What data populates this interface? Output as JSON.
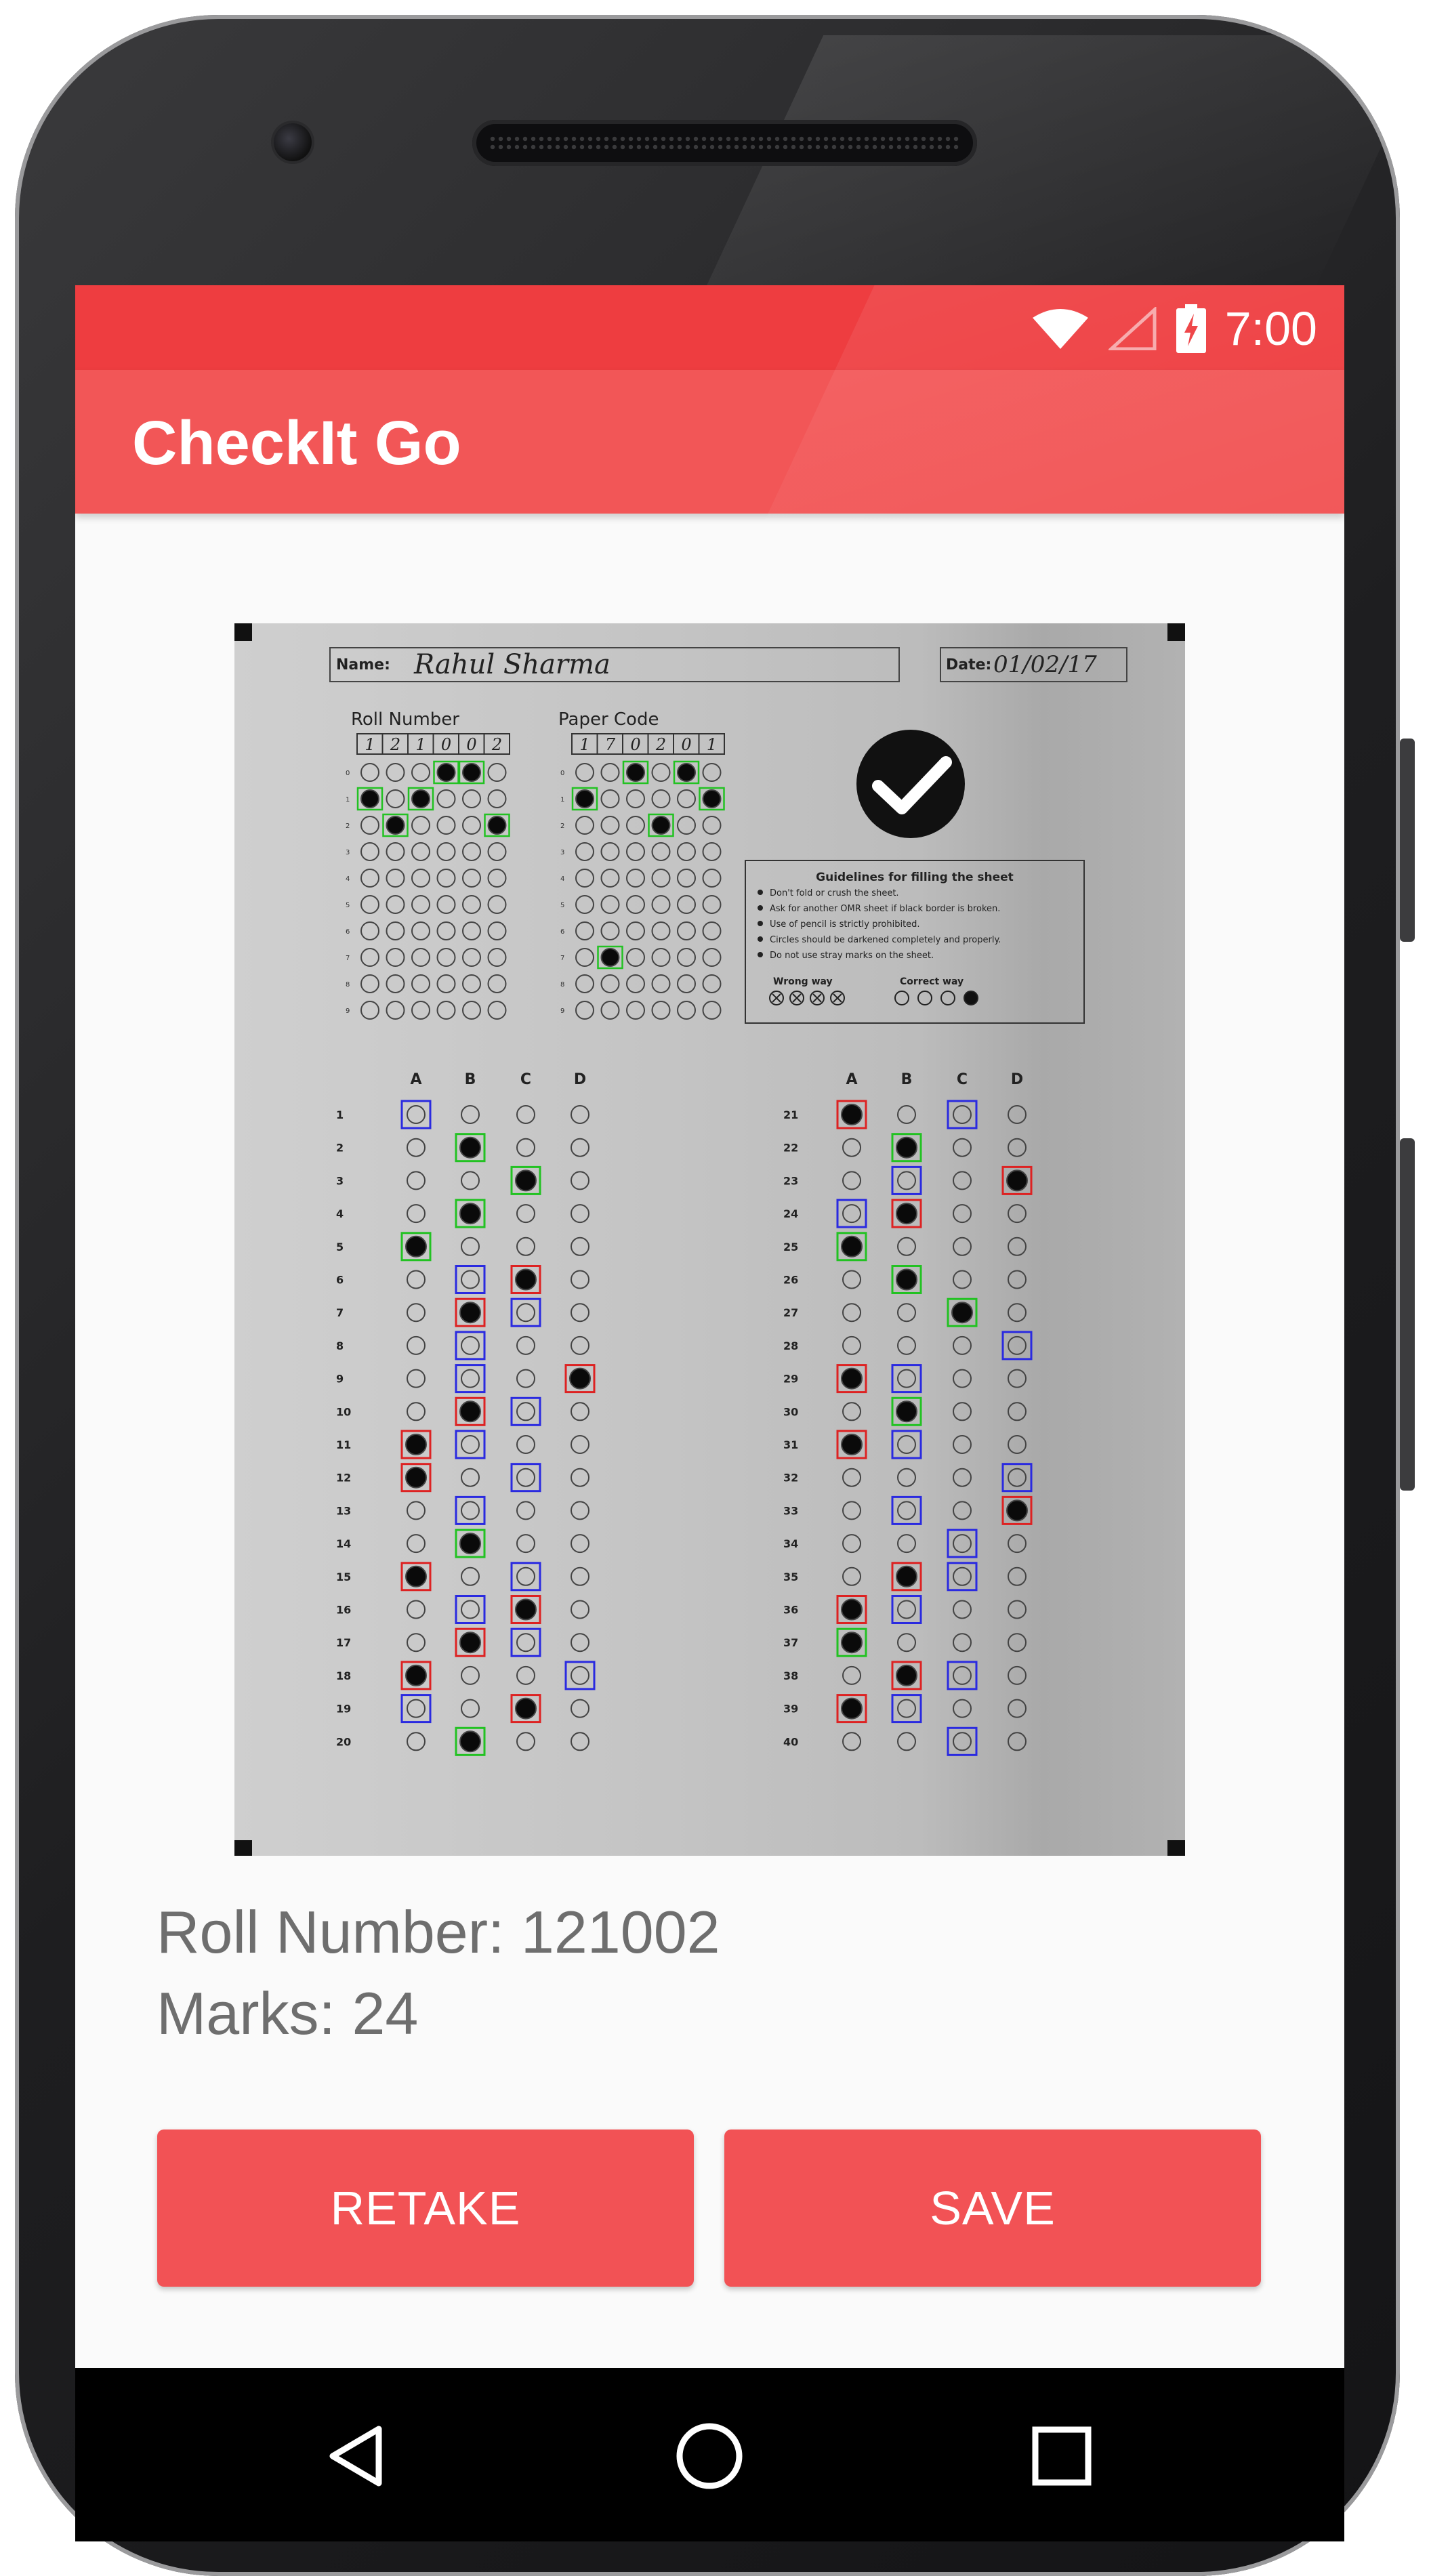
{
  "status_bar": {
    "time": "7:00",
    "icons": [
      "wifi-icon",
      "cell-signal-icon",
      "battery-charging-icon"
    ]
  },
  "app_bar": {
    "title": "CheckIt Go"
  },
  "omr_sheet": {
    "name_label": "Name:",
    "name_value": "Rahul Sharma",
    "date_label": "Date:",
    "date_value": "01/02/17",
    "roll_number_label": "Roll Number",
    "roll_number_digits": [
      "1",
      "2",
      "1",
      "0",
      "0",
      "2"
    ],
    "paper_code_label": "Paper Code",
    "paper_code_digits": [
      "1",
      "7",
      "0",
      "2",
      "0",
      "1"
    ],
    "guidelines_title": "Guidelines for filling the sheet",
    "guidelines": [
      "Don't fold or crush the sheet.",
      "Ask for another OMR sheet if black border is broken.",
      "Use of pencil is strictly prohibited.",
      "Circles should be darkened completely and properly.",
      "Do not use stray marks on the sheet."
    ],
    "wrong_way_label": "Wrong way",
    "correct_way_label": "Correct way",
    "option_headers": [
      "A",
      "B",
      "C",
      "D"
    ],
    "question_numbers_left": [
      "1",
      "2",
      "3",
      "4",
      "5",
      "6",
      "7",
      "8",
      "9",
      "10",
      "11",
      "12",
      "13",
      "14",
      "15",
      "16",
      "17",
      "18",
      "19",
      "20"
    ],
    "question_numbers_right": [
      "21",
      "22",
      "23",
      "24",
      "25",
      "26",
      "27",
      "28",
      "29",
      "30",
      "31",
      "32",
      "33",
      "34",
      "35",
      "36",
      "37",
      "38",
      "39",
      "40"
    ],
    "digit_rows": [
      "0",
      "1",
      "2",
      "3",
      "4",
      "5",
      "6",
      "7",
      "8",
      "9"
    ],
    "marked_answers": {
      "1": null,
      "2": "B",
      "3": "C",
      "4": "B",
      "5": "A",
      "6": "C",
      "7": "B",
      "8": null,
      "9": "D",
      "10": "B",
      "11": "A",
      "12": "A",
      "13": null,
      "14": "B",
      "15": "A",
      "16": "C",
      "17": "B",
      "18": "A",
      "19": "C",
      "20": "B",
      "21": "A",
      "22": "B",
      "23": "D",
      "24": "B",
      "25": "A",
      "26": "B",
      "27": "C",
      "28": null,
      "29": "A",
      "30": "B",
      "31": "A",
      "32": null,
      "33": "D",
      "34": null,
      "35": "B",
      "36": "A",
      "37": "A",
      "38": "B",
      "39": "A",
      "40": null
    },
    "correct_answers": {
      "1": "A",
      "2": "B",
      "3": "C",
      "4": "B",
      "5": "A",
      "6": "B",
      "7": "C",
      "8": "B",
      "9": "B",
      "10": "C",
      "11": "B",
      "12": "C",
      "13": "B",
      "14": "B",
      "15": "C",
      "16": "B",
      "17": "C",
      "18": "D",
      "19": "A",
      "20": "B",
      "21": "C",
      "22": "B",
      "23": "B",
      "24": "A",
      "25": "A",
      "26": "B",
      "27": "C",
      "28": "D",
      "29": "B",
      "30": "B",
      "31": "B",
      "32": "D",
      "33": "B",
      "34": "C",
      "35": "C",
      "36": "B",
      "37": "A",
      "38": "C",
      "39": "B",
      "40": "C"
    },
    "colors": {
      "correct": "#22c222",
      "wrong": "#dd2222",
      "expected": "#2a2ae0"
    }
  },
  "results": {
    "roll_number_text": "Roll Number: 121002",
    "marks_text": "Marks: 24"
  },
  "buttons": {
    "retake_label": "RETAKE",
    "save_label": "SAVE"
  },
  "nav_bar": {
    "icons": [
      "back-icon",
      "home-icon",
      "recents-icon"
    ]
  },
  "colors": {
    "status_bar": "#ee3d40",
    "app_bar": "#f25657",
    "button": "#f25255",
    "info_text": "#6e6e6e"
  }
}
